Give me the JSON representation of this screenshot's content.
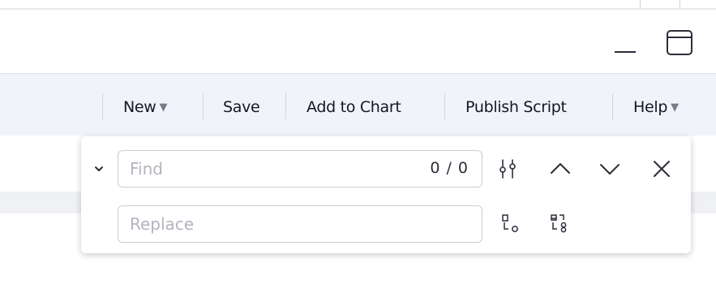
{
  "toolbar": {
    "new_label": "New",
    "save_label": "Save",
    "add_to_chart_label": "Add to Chart",
    "publish_script_label": "Publish Script",
    "help_label": "Help",
    "caret_glyph": "▼"
  },
  "find_widget": {
    "find_placeholder": "Find",
    "find_value": "",
    "match_count": "0 / 0",
    "replace_placeholder": "Replace",
    "replace_value": ""
  },
  "icons": {
    "window_minimize": "minimize-icon",
    "window_maximize": "maximize-icon",
    "toggle_replace": "chevron-down-icon",
    "search_options": "search-options-icon",
    "previous_match": "chevron-up-icon",
    "next_match": "chevron-down-icon",
    "close": "close-icon",
    "replace_one": "replace-icon",
    "replace_all": "replace-all-icon"
  },
  "colors": {
    "toolbar_bg": "#f0f3fa",
    "text": "#131722",
    "placeholder": "#b2b5be",
    "icon": "#2a2e39",
    "border": "#c9ccd3"
  }
}
